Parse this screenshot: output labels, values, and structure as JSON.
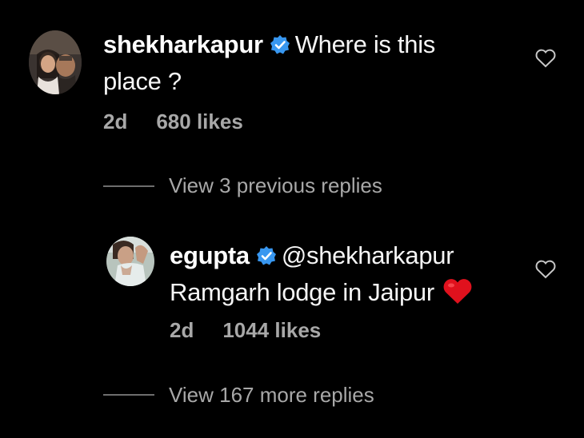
{
  "comment": {
    "username": "shekharkapur",
    "text_line1": "Where is this",
    "text_line2": "place ?",
    "age": "2d",
    "likes": "680 likes"
  },
  "view_previous": "View 3 previous replies",
  "reply": {
    "username": "egupta",
    "mention": "@shekharkapur",
    "text": "Ramgarh lodge in Jaipur",
    "age": "2d",
    "likes": "1044 likes"
  },
  "view_more": "View 167 more replies",
  "colors": {
    "background": "#000000",
    "verified": "#3897f0",
    "secondary_text": "#a8a8a8",
    "heart_emoji": "#e0111d"
  },
  "icons": {
    "verified": "verified-badge-icon",
    "like": "heart-outline-icon",
    "emoji": "red-heart-emoji"
  }
}
